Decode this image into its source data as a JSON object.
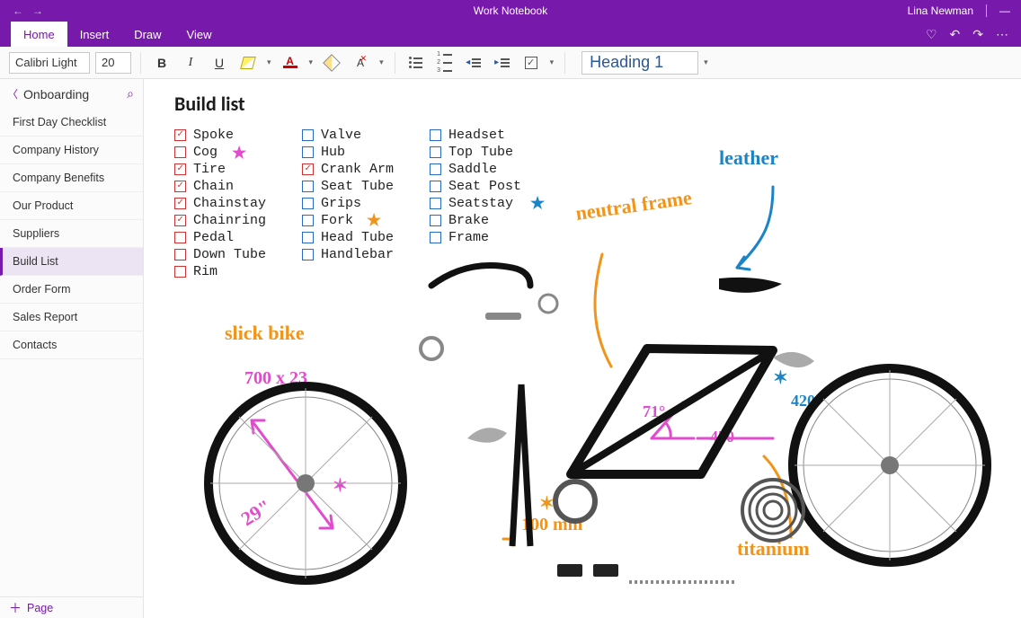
{
  "window": {
    "title": "Work Notebook",
    "user": "Lina Newman"
  },
  "ribbon": {
    "tabs": [
      "Home",
      "Insert",
      "Draw",
      "View"
    ],
    "active_tab": "Home"
  },
  "toolbar": {
    "font_name": "Calibri Light",
    "font_size": "20",
    "style_picker": "Heading 1"
  },
  "section": {
    "name": "Onboarding",
    "pages": [
      "First Day Checklist",
      "Company History",
      "Company Benefits",
      "Our Product",
      "Suppliers",
      "Build List",
      "Order Form",
      "Sales Report",
      "Contacts"
    ],
    "selected": "Build List",
    "add_page_label": "Page"
  },
  "page": {
    "title": "Build list",
    "columns": [
      [
        {
          "label": "Spoke",
          "checked": true
        },
        {
          "label": "Cog",
          "checked": false
        },
        {
          "label": "Tire",
          "checked": true
        },
        {
          "label": "Chain",
          "checked": true
        },
        {
          "label": "Chainstay",
          "checked": true
        },
        {
          "label": "Chainring",
          "checked": true
        },
        {
          "label": "Pedal",
          "checked": false
        },
        {
          "label": "Down Tube",
          "checked": false
        },
        {
          "label": "Rim",
          "checked": false
        }
      ],
      [
        {
          "label": "Valve",
          "checked": false
        },
        {
          "label": "Hub",
          "checked": false
        },
        {
          "label": "Crank Arm",
          "checked": true
        },
        {
          "label": "Seat Tube",
          "checked": false
        },
        {
          "label": "Grips",
          "checked": false
        },
        {
          "label": "Fork",
          "checked": false
        },
        {
          "label": "Head Tube",
          "checked": false
        },
        {
          "label": "Handlebar",
          "checked": false
        }
      ],
      [
        {
          "label": "Headset",
          "checked": false
        },
        {
          "label": "Top Tube",
          "checked": false
        },
        {
          "label": "Saddle",
          "checked": false
        },
        {
          "label": "Seat Post",
          "checked": false
        },
        {
          "label": "Seatstay",
          "checked": false
        },
        {
          "label": "Brake",
          "checked": false
        },
        {
          "label": "Frame",
          "checked": false
        }
      ]
    ]
  },
  "ink": {
    "slick_bike": "slick bike",
    "tire_size": "700 x 23",
    "wheel_diam": "29\"",
    "neutral_frame": "neutral frame",
    "leather": "leather",
    "titanium": "titanium",
    "hundred_mm": "100 mm",
    "angle": "71°",
    "length_450": "450",
    "length_420": "420"
  }
}
